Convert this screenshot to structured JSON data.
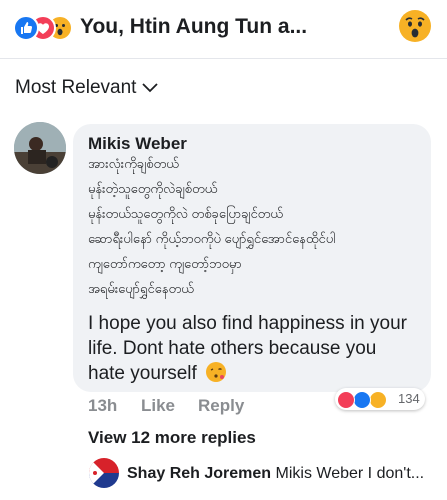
{
  "header": {
    "reactors": "You, Htin Aung Tun a...",
    "reaction_icons": [
      "like-icon",
      "love-icon",
      "wow-icon"
    ]
  },
  "sort": {
    "label": "Most Relevant"
  },
  "comment": {
    "author": "Mikis Weber",
    "myanmar_lines": [
      "အားလုံးကိုချစ်တယ်",
      "မုန်းတဲ့သူတွေကိုလဲချစ်တယ်",
      "မုန်းတယ်သူတွေကိုလဲ တစ်ခုပြောချင်တယ်",
      "ဆောရီးပါနော် ကိုယ့်ဘဝကိုပဲ ပျော်ရွှင်အောင်နေထိုင်ပါ",
      "ကျတော်ကတော့ ကျတော့်ဘဝမှာ",
      "အရမ်းပျော်ရွှင်နေတယ်"
    ],
    "english": "I hope you also find happiness in your life. Dont hate others because you hate yourself",
    "time": "13h",
    "like_label": "Like",
    "reply_label": "Reply",
    "reaction_count": "134"
  },
  "view_more": "View 12 more replies",
  "reply_preview": {
    "author": "Shay Reh Joremen",
    "text": "Mikis Weber I don't..."
  }
}
